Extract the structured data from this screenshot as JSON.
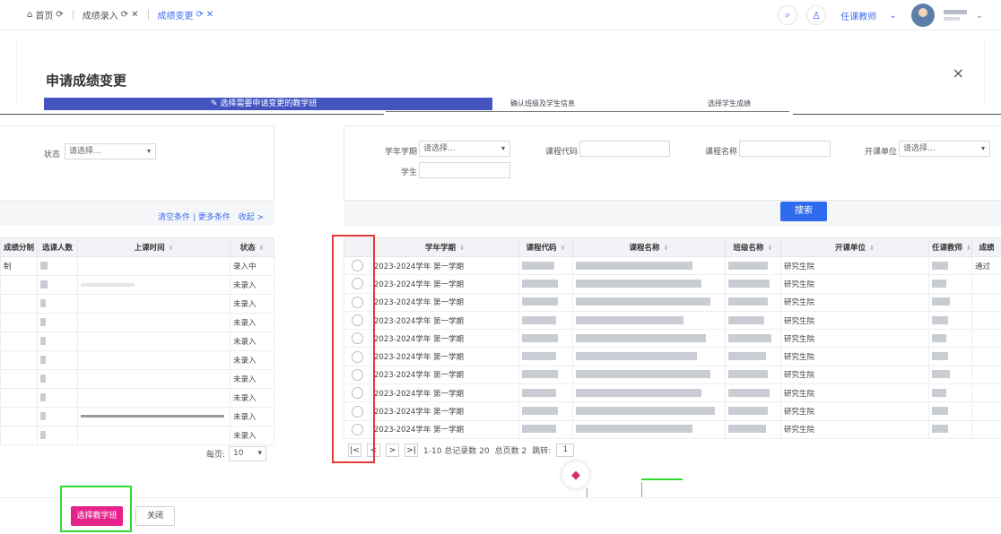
{
  "topbar": {
    "tabs": [
      {
        "label": "首页"
      },
      {
        "label": "成绩录入"
      },
      {
        "label": "成绩变更"
      }
    ],
    "role": "任课教师"
  },
  "modal": {
    "title": "申请成绩变更",
    "steps": [
      {
        "label": "选择需要申请变更的教学班"
      },
      {
        "label": "确认班级及学生信息"
      },
      {
        "label": "选择学生成绩"
      }
    ],
    "close_symbol": "×"
  },
  "left": {
    "status_label": "状态",
    "status_placeholder": "请选择...",
    "footer": {
      "clear": "清空条件",
      "sep": "|",
      "more": "更多条件",
      "collapse": "收起 >"
    },
    "columns": [
      "成绩分制",
      "选课人数",
      "上课时间",
      "状态"
    ],
    "rows": [
      {
        "scheme": "制",
        "status": "录入中"
      },
      {
        "scheme": "",
        "status": "未录入"
      },
      {
        "scheme": "",
        "status": "未录入"
      },
      {
        "scheme": "",
        "status": "未录入"
      },
      {
        "scheme": "",
        "status": "未录入"
      },
      {
        "scheme": "",
        "status": "未录入"
      },
      {
        "scheme": "",
        "status": "未录入"
      },
      {
        "scheme": "",
        "status": "未录入"
      },
      {
        "scheme": "",
        "status": "未录入"
      },
      {
        "scheme": "",
        "status": "未录入"
      }
    ],
    "per_page_label": "每页:",
    "per_page_value": "10"
  },
  "right": {
    "filters": {
      "term_label": "学年学期",
      "term_placeholder": "请选择...",
      "code_label": "课程代码",
      "name_label": "课程名称",
      "unit_label": "开课单位",
      "unit_placeholder": "请选择...",
      "student_label": "学生"
    },
    "search_label": "搜索",
    "columns": [
      "学年学期",
      "课程代码",
      "课程名称",
      "班级名称",
      "开课单位",
      "任课教师",
      "成绩"
    ],
    "rows": [
      {
        "term": "2023-2024学年 第一学期",
        "unit": "研究生院",
        "status": "通过"
      },
      {
        "term": "2023-2024学年 第一学期",
        "unit": "研究生院",
        "status": ""
      },
      {
        "term": "2023-2024学年 第一学期",
        "unit": "研究生院",
        "status": ""
      },
      {
        "term": "2023-2024学年 第一学期",
        "unit": "研究生院",
        "status": ""
      },
      {
        "term": "2023-2024学年 第一学期",
        "unit": "研究生院",
        "status": ""
      },
      {
        "term": "2023-2024学年 第一学期",
        "unit": "研究生院",
        "status": ""
      },
      {
        "term": "2023-2024学年 第一学期",
        "unit": "研究生院",
        "status": ""
      },
      {
        "term": "2023-2024学年 第一学期",
        "unit": "研究生院",
        "status": ""
      },
      {
        "term": "2023-2024学年 第一学期",
        "unit": "研究生院",
        "status": ""
      },
      {
        "term": "2023-2024学年 第一学期",
        "unit": "研究生院",
        "status": ""
      }
    ],
    "pager": {
      "range": "1-10 总记录数 20",
      "pages": "总页数 2",
      "jump_label": "跳转:",
      "jump_value": "1"
    }
  },
  "footer": {
    "select_button": "选择教学班",
    "close_button": "关闭"
  }
}
